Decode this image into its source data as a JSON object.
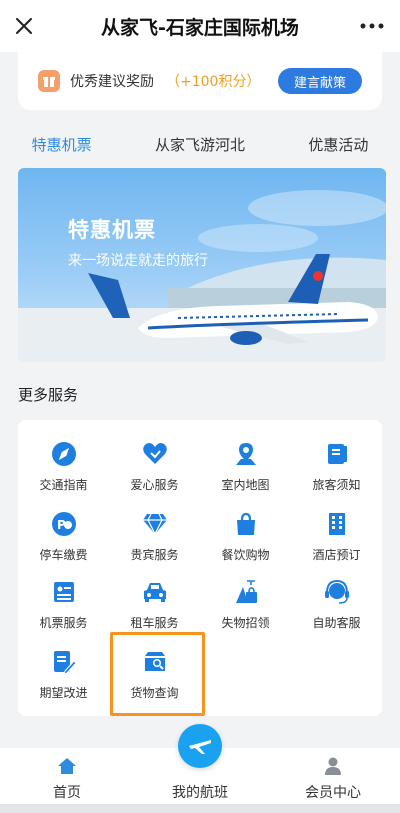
{
  "header": {
    "title": "从家飞-石家庄国际机场"
  },
  "suggest": {
    "label": "优秀建议奖励",
    "points": "（+100积分）",
    "button": "建言献策"
  },
  "tabs": [
    {
      "label": "特惠机票",
      "active": true
    },
    {
      "label": "从家飞游河北",
      "active": false
    },
    {
      "label": "优惠活动",
      "active": false
    }
  ],
  "banner": {
    "title": "特惠机票",
    "subtitle": "来一场说走就走的旅行"
  },
  "more_services": {
    "title": "更多服务",
    "items": [
      {
        "label": "交通指南",
        "icon": "compass-icon"
      },
      {
        "label": "爱心服务",
        "icon": "heart-icon"
      },
      {
        "label": "室内地图",
        "icon": "map-pin-icon"
      },
      {
        "label": "旅客须知",
        "icon": "book-icon"
      },
      {
        "label": "停车缴费",
        "icon": "parking-icon"
      },
      {
        "label": "贵宾服务",
        "icon": "diamond-icon"
      },
      {
        "label": "餐饮购物",
        "icon": "shopping-bag-icon"
      },
      {
        "label": "酒店预订",
        "icon": "hotel-icon"
      },
      {
        "label": "机票服务",
        "icon": "ticket-icon"
      },
      {
        "label": "租车服务",
        "icon": "car-icon"
      },
      {
        "label": "失物招领",
        "icon": "lost-found-icon"
      },
      {
        "label": "自助客服",
        "icon": "headset-icon"
      },
      {
        "label": "期望改进",
        "icon": "edit-icon"
      },
      {
        "label": "货物查询",
        "icon": "cargo-search-icon"
      }
    ]
  },
  "bottom_nav": {
    "home": "首页",
    "flights": "我的航班",
    "member": "会员中心"
  },
  "colors": {
    "accent": "#2d8ce0",
    "button": "#2d7be0",
    "highlight": "#f7931e",
    "points": "#f0a020"
  }
}
